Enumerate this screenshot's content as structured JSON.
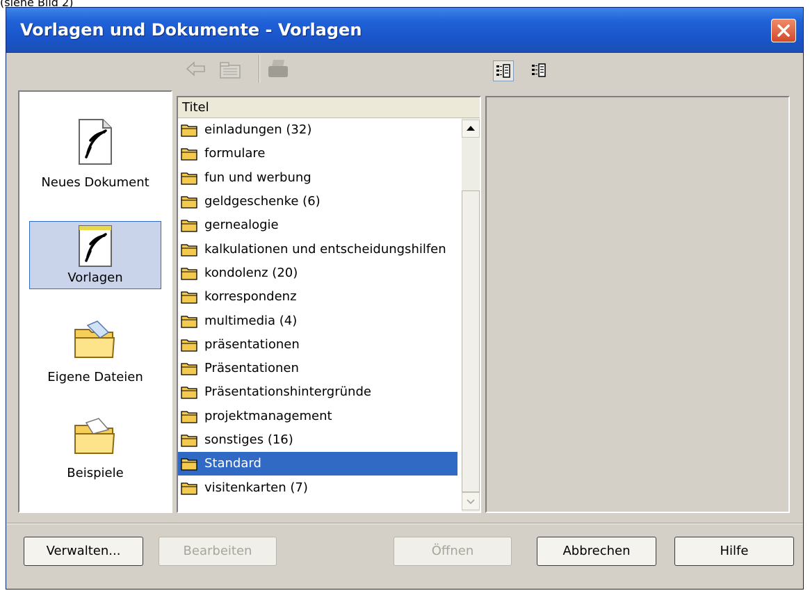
{
  "window": {
    "title": "Vorlagen und Dokumente - Vorlagen",
    "top_fragment": "(siehe Bild 2)"
  },
  "categories": [
    {
      "label": "Neues Dokument",
      "icon": "new-document-icon",
      "selected": false
    },
    {
      "label": "Vorlagen",
      "icon": "templates-icon",
      "selected": true
    },
    {
      "label": "Eigene Dateien",
      "icon": "my-files-folder-icon",
      "selected": false
    },
    {
      "label": "Beispiele",
      "icon": "examples-folder-icon",
      "selected": false
    }
  ],
  "list": {
    "header": "Titel",
    "items": [
      "einladungen (32)",
      "formulare",
      "fun und werbung",
      "geldgeschenke (6)",
      "gernealogie",
      "kalkulationen und entscheidungshilfen",
      "kondolenz (20)",
      "korrespondenz",
      "multimedia (4)",
      "präsentationen",
      "Präsentationen",
      "Präsentationshintergründe",
      "projektmanagement",
      "sonstiges (16)",
      "Standard",
      "visitenkarten (7)"
    ],
    "selected": "Standard"
  },
  "buttons": {
    "manage": "Verwalten...",
    "edit": "Bearbeiten",
    "open": "Öffnen",
    "cancel": "Abbrechen",
    "help": "Hilfe"
  },
  "colors": {
    "titlebar": "#1c5ad8",
    "selection": "#316ac5",
    "dialog_bg": "#d4d0c8"
  }
}
